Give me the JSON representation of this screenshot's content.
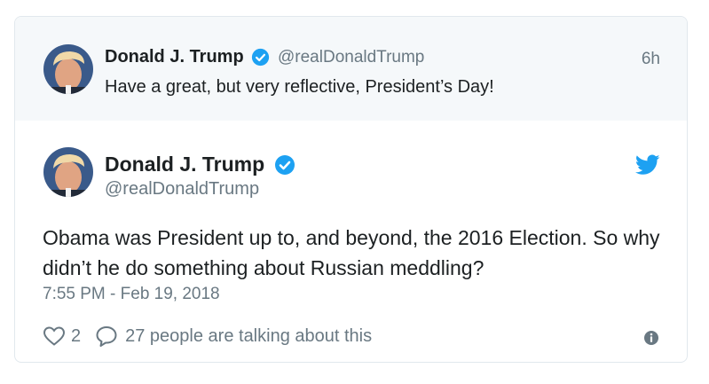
{
  "parent_tweet": {
    "display_name": "Donald J. Trump",
    "handle": "@realDonaldTrump",
    "time_ago": "6h",
    "text": "Have a great, but very reflective, President’s Day!",
    "verified": true
  },
  "main_tweet": {
    "display_name": "Donald J. Trump",
    "handle": "@realDonaldTrump",
    "text": "Obama was President up to, and beyond, the 2016 Election. So why didn’t he do something about Russian meddling?",
    "timestamp": "7:55 PM - Feb 19, 2018",
    "verified": true
  },
  "actions": {
    "like_count": "2",
    "talking_text": "27 people are talking about this"
  },
  "icons": {
    "verified": "verified-badge-icon",
    "brand": "twitter-bird-icon",
    "like": "heart-icon",
    "reply": "reply-bubble-icon",
    "info": "info-icon"
  },
  "colors": {
    "verified_blue": "#1da1f2",
    "secondary_text": "#697882",
    "primary_text": "#1c2022",
    "parent_background": "#f5f8fa",
    "border": "#e1e8ed"
  }
}
